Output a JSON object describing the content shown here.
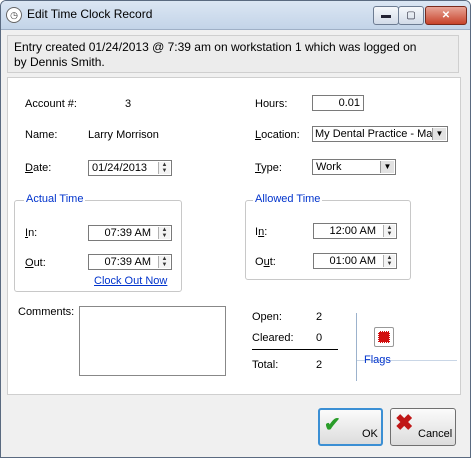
{
  "window": {
    "title": "Edit Time Clock Record",
    "app_icon": "clock-icon",
    "controls": {
      "minimize": "▬",
      "maximize": "▢",
      "close": "✕"
    }
  },
  "banner": {
    "line1": "Entry created 01/24/2013 @ 7:39 am on workstation 1 which was logged on",
    "line2": "by Dennis Smith."
  },
  "account": {
    "label": "Account #:",
    "value": "3"
  },
  "name": {
    "label": "Name:",
    "value": "Larry Morrison"
  },
  "date": {
    "label_underlined": "D",
    "label_rest": "ate:",
    "value": "01/24/2013"
  },
  "hours": {
    "label": "Hours:",
    "value": "0.01"
  },
  "location": {
    "label_underlined": "L",
    "label_rest": "ocation:",
    "value": "My Dental Practice - Ma"
  },
  "type": {
    "label_underlined": "T",
    "label_rest": "ype:",
    "value": "Work"
  },
  "actual_time": {
    "title": "Actual Time",
    "in_label_underlined": "I",
    "in_label_rest": "n:",
    "in_value": "07:39 AM",
    "out_label_underlined": "O",
    "out_label_rest": "ut:",
    "out_value": "07:39 AM",
    "clock_out_link": "Clock Out Now"
  },
  "allowed_time": {
    "title": "Allowed Time",
    "in_label_pre": "I",
    "in_label_underlined": "n",
    "in_label_rest": ":",
    "in_value": "12:00 AM",
    "out_label_pre": "O",
    "out_label_underlined": "u",
    "out_label_rest": "t:",
    "out_value": "01:00 AM"
  },
  "comments": {
    "label": "Comments:",
    "value": ""
  },
  "summary": {
    "open_label": "Open:",
    "open_value": "2",
    "cleared_label": "Cleared:",
    "cleared_value": "0",
    "total_label": "Total:",
    "total_value": "2"
  },
  "flags": {
    "label": "Flags",
    "icon": "flag-icon"
  },
  "buttons": {
    "ok": "OK",
    "cancel": "Cancel"
  },
  "colors": {
    "link": "#0033cc",
    "ok_border": "#3b8fd4",
    "flag": "#d20f0f"
  }
}
